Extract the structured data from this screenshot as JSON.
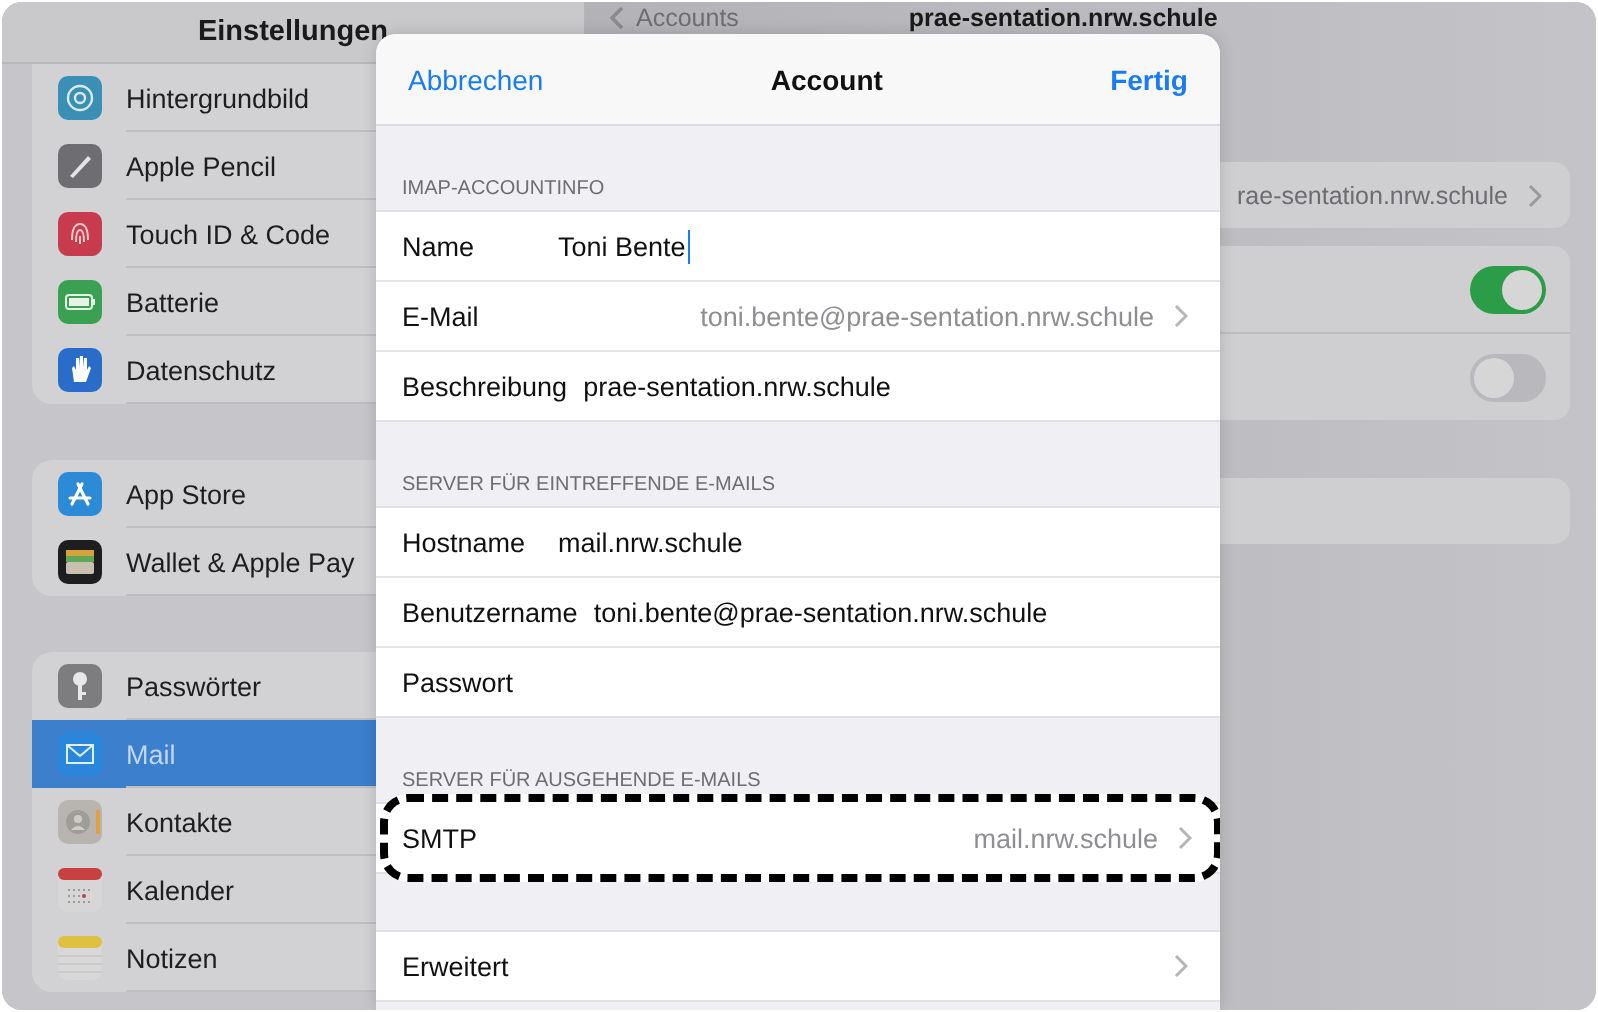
{
  "sidebar": {
    "title": "Einstellungen",
    "groups": [
      [
        {
          "label": "Hintergrundbild",
          "kind": "wallpaper",
          "selected": false
        },
        {
          "label": "Apple Pencil",
          "kind": "pencil",
          "selected": false
        },
        {
          "label": "Touch ID & Code",
          "kind": "fingerprint",
          "selected": false
        },
        {
          "label": "Batterie",
          "kind": "battery",
          "selected": false
        },
        {
          "label": "Datenschutz",
          "kind": "hand",
          "selected": false
        }
      ],
      [
        {
          "label": "App Store",
          "kind": "appstore",
          "selected": false
        },
        {
          "label": "Wallet & Apple Pay",
          "kind": "wallet",
          "selected": false
        }
      ],
      [
        {
          "label": "Passwörter",
          "kind": "key",
          "selected": false
        },
        {
          "label": "Mail",
          "kind": "mail",
          "selected": true
        },
        {
          "label": "Kontakte",
          "kind": "contacts",
          "selected": false
        },
        {
          "label": "Kalender",
          "kind": "calendar",
          "selected": false
        },
        {
          "label": "Notizen",
          "kind": "notes",
          "selected": false
        }
      ]
    ]
  },
  "detail": {
    "back": "Accounts",
    "title": "prae-sentation.nrw.schule",
    "account_value": "rae-sentation.nrw.schule",
    "toggles": [
      {
        "on": true
      },
      {
        "on": false
      }
    ]
  },
  "sheet": {
    "cancel": "Abbrechen",
    "title": "Account",
    "done": "Fertig",
    "sections": [
      {
        "header": "IMAP-ACCOUNTINFO",
        "rows": [
          {
            "kind": "field",
            "label": "Name",
            "value": "Toni Bente",
            "focused": true,
            "highlighted": false
          },
          {
            "kind": "link",
            "label": "E-Mail",
            "value": "toni.bente@prae-sentation.nrw.schule",
            "focused": false,
            "highlighted": false
          },
          {
            "kind": "field",
            "label": "Beschreibung",
            "value": "prae-sentation.nrw.schule",
            "focused": false,
            "highlighted": false
          }
        ]
      },
      {
        "header": "SERVER FÜR EINTREFFENDE E-MAILS",
        "rows": [
          {
            "kind": "field",
            "label": "Hostname",
            "value": "mail.nrw.schule",
            "focused": false,
            "highlighted": false
          },
          {
            "kind": "field",
            "label": "Benutzername",
            "value": "toni.bente@prae-sentation.nrw.schule",
            "focused": false,
            "highlighted": false
          },
          {
            "kind": "field",
            "label": "Passwort",
            "focused": false,
            "highlighted": false
          }
        ]
      },
      {
        "header": "SERVER FÜR AUSGEHENDE E-MAILS",
        "rows": [
          {
            "kind": "link",
            "label": "SMTP",
            "value": "mail.nrw.schule",
            "focused": false,
            "highlighted": true
          }
        ]
      },
      {
        "rows": [
          {
            "kind": "link",
            "label": "Erweitert",
            "focused": false,
            "highlighted": false
          }
        ]
      }
    ]
  }
}
